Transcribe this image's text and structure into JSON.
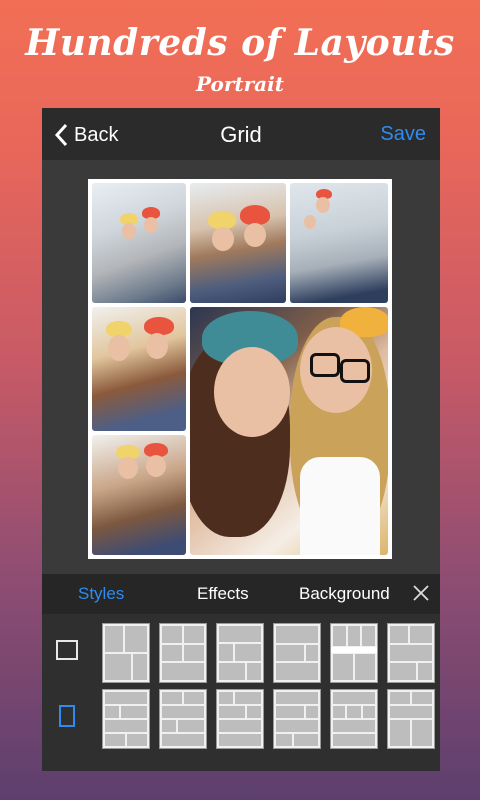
{
  "promo": {
    "title": "Hundreds of Layouts",
    "subtitle": "Portrait"
  },
  "topbar": {
    "back_label": "Back",
    "title": "Grid",
    "save_label": "Save"
  },
  "tabs": [
    {
      "label": "Styles",
      "active": true
    },
    {
      "label": "Effects",
      "active": false
    },
    {
      "label": "Background",
      "active": false
    }
  ],
  "ratios": [
    {
      "name": "square",
      "selected": false
    },
    {
      "name": "portrait",
      "selected": true
    }
  ],
  "colors": {
    "accent": "#2e8cf0",
    "toolbar": "#2b2b2b",
    "panel": "#2f2f2f"
  },
  "layout_thumbnails": {
    "rows": 2,
    "per_row": 6,
    "highlighted": 5
  }
}
